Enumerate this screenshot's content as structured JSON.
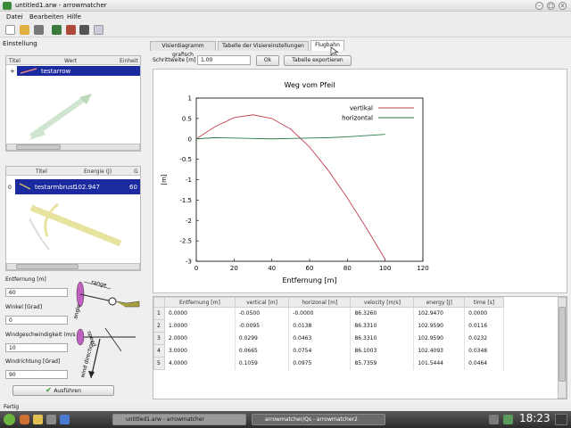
{
  "window": {
    "title": "untitled1.arw - arrowmatcher",
    "close_label": "x"
  },
  "menu": [
    "Datei",
    "Bearbeiten",
    "Hilfe"
  ],
  "left": {
    "section_title": "Einstellung",
    "arrow_table": {
      "headers": [
        "Titel",
        "Wert",
        "Einheit"
      ],
      "row": {
        "expander": "+",
        "name": "testarrow"
      }
    },
    "bow_table": {
      "headers": [
        "Titel",
        "Energie (J)",
        "G"
      ],
      "row": {
        "index": "0",
        "name": "testarmbrust",
        "energy": "102.947",
        "extra": "60"
      }
    },
    "fields": {
      "entfernung_label": "Entfernung [m]",
      "entfernung_value": "60",
      "winkel_label": "Winkel [Grad]",
      "winkel_value": "0",
      "windspeed_label": "Windgeschwindigkeit (m/s",
      "windspeed_value": "10",
      "windrichtung_label": "Windrichtung [Grad]",
      "windrichtung_value": "90"
    },
    "diagram1": {
      "range": "range",
      "angle": "angle"
    },
    "diagram2": {
      "speed": "speed",
      "wind_direction": "wind direction"
    },
    "run_button": "Ausführen"
  },
  "tabs": [
    "Visierdiagramm grafisch",
    "Tabelle der Visiereinstellungen",
    "Flugbahn"
  ],
  "step": {
    "label": "Schrittweite [m]",
    "value": "1.00",
    "ok_label": "Ok",
    "export_label": "Tabelle exportieren"
  },
  "chart_data": {
    "type": "line",
    "title": "Weg vom Pfeil",
    "xlabel": "Entfernung [m]",
    "ylabel": "[m]",
    "xlim": [
      0,
      120
    ],
    "ylim": [
      -3,
      1
    ],
    "xticks": [
      "0",
      "20",
      "40",
      "60",
      "80",
      "100",
      "120"
    ],
    "yticks": [
      "1",
      "0.5",
      "0",
      "-0.5",
      "-1",
      "-1.5",
      "-2",
      "-2.5",
      "-3"
    ],
    "series": [
      {
        "name": "vertikal",
        "color": "#c04050",
        "x": [
          0,
          10,
          20,
          30,
          40,
          50,
          60,
          70,
          80,
          90,
          100
        ],
        "y": [
          0,
          0.3,
          0.52,
          0.59,
          0.5,
          0.24,
          -0.2,
          -0.78,
          -1.45,
          -2.18,
          -2.95
        ]
      },
      {
        "name": "horizontal",
        "color": "#2a7a4a",
        "x": [
          0,
          10,
          20,
          30,
          40,
          50,
          60,
          70,
          80,
          90,
          100
        ],
        "y": [
          0,
          0.03,
          0.02,
          0.01,
          0.0,
          0.01,
          0.02,
          0.03,
          0.05,
          0.08,
          0.11
        ]
      }
    ],
    "legend": "top-right"
  },
  "data_table": {
    "headers": [
      "Entfernung [m]",
      "vertical [m]",
      "horizonal [m]",
      "velocity [m/s]",
      "energy [J]",
      "time [s]"
    ],
    "rows": [
      [
        "1",
        "0.0000",
        "-0.0500",
        "-0.0000",
        "86.3260",
        "102.9470",
        "0.0000"
      ],
      [
        "2",
        "1.0000",
        "-0.0095",
        "0.0138",
        "86.3310",
        "102.9590",
        "0.0116"
      ],
      [
        "3",
        "2.0000",
        "0.0299",
        "0.0463",
        "86.3310",
        "102.9590",
        "0.0232"
      ],
      [
        "4",
        "3.0000",
        "0.0665",
        "0.0754",
        "86.1003",
        "102.4093",
        "0.0348"
      ],
      [
        "5",
        "4.0000",
        "0.1059",
        "0.0975",
        "85.7359",
        "101.5444",
        "0.0464"
      ]
    ]
  },
  "status": "Fertig",
  "taskbar": {
    "task1": "untitled1.arw - arrowmatcher",
    "task2": "arrowmatcher/Qs - arrowmatcher2",
    "clock": "18:23"
  }
}
